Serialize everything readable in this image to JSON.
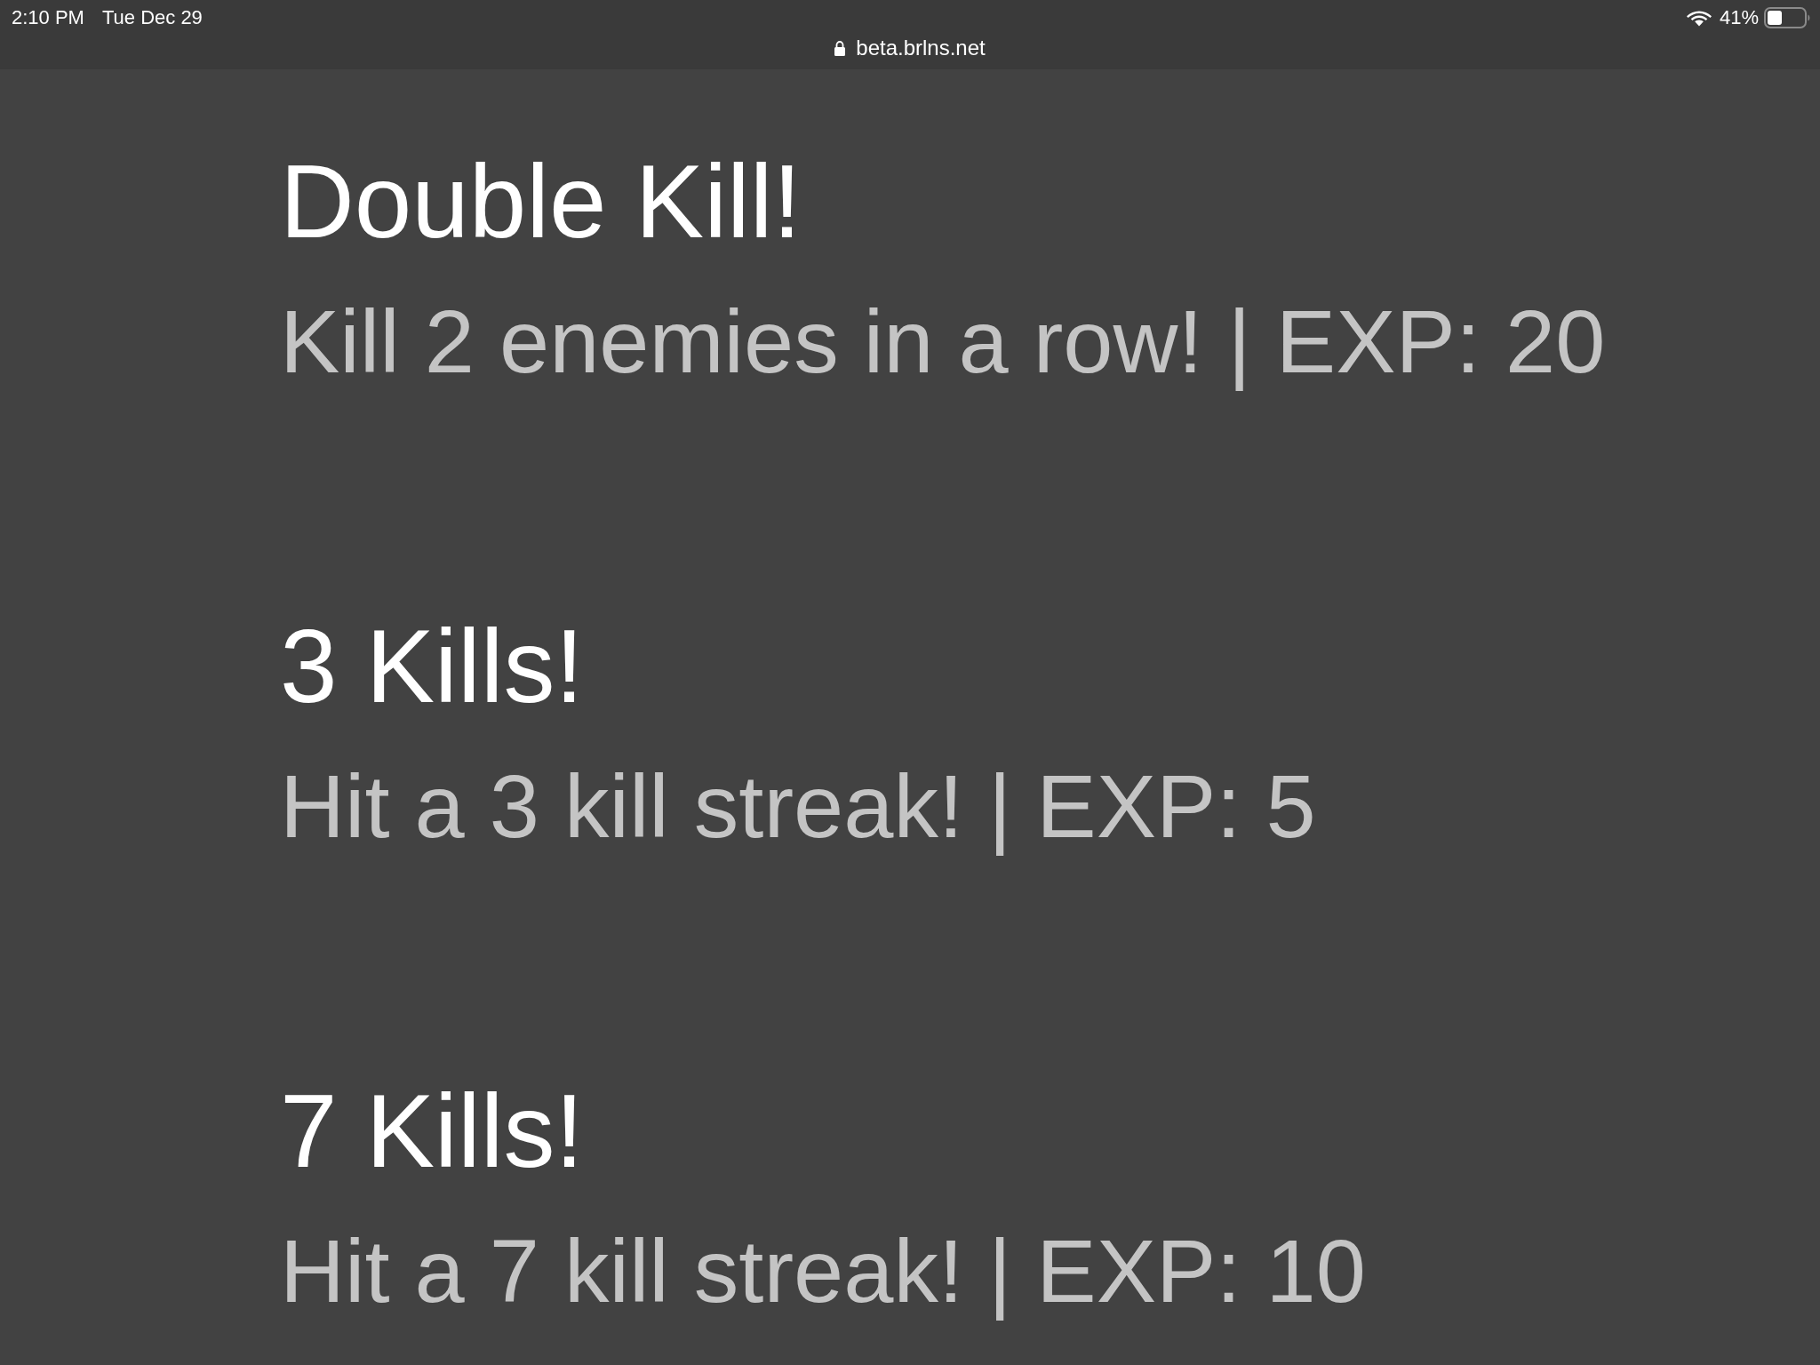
{
  "status_bar": {
    "time": "2:10 PM",
    "date": "Tue Dec 29",
    "url": "beta.brlns.net",
    "battery": "41%"
  },
  "achievements": [
    {
      "title": "Double Kill!",
      "description": "Kill 2 enemies in a row! | EXP: 20"
    },
    {
      "title": "3 Kills!",
      "description": "Hit a 3 kill streak! | EXP: 5"
    },
    {
      "title": "7 Kills!",
      "description": "Hit a 7 kill streak! | EXP: 10"
    }
  ]
}
